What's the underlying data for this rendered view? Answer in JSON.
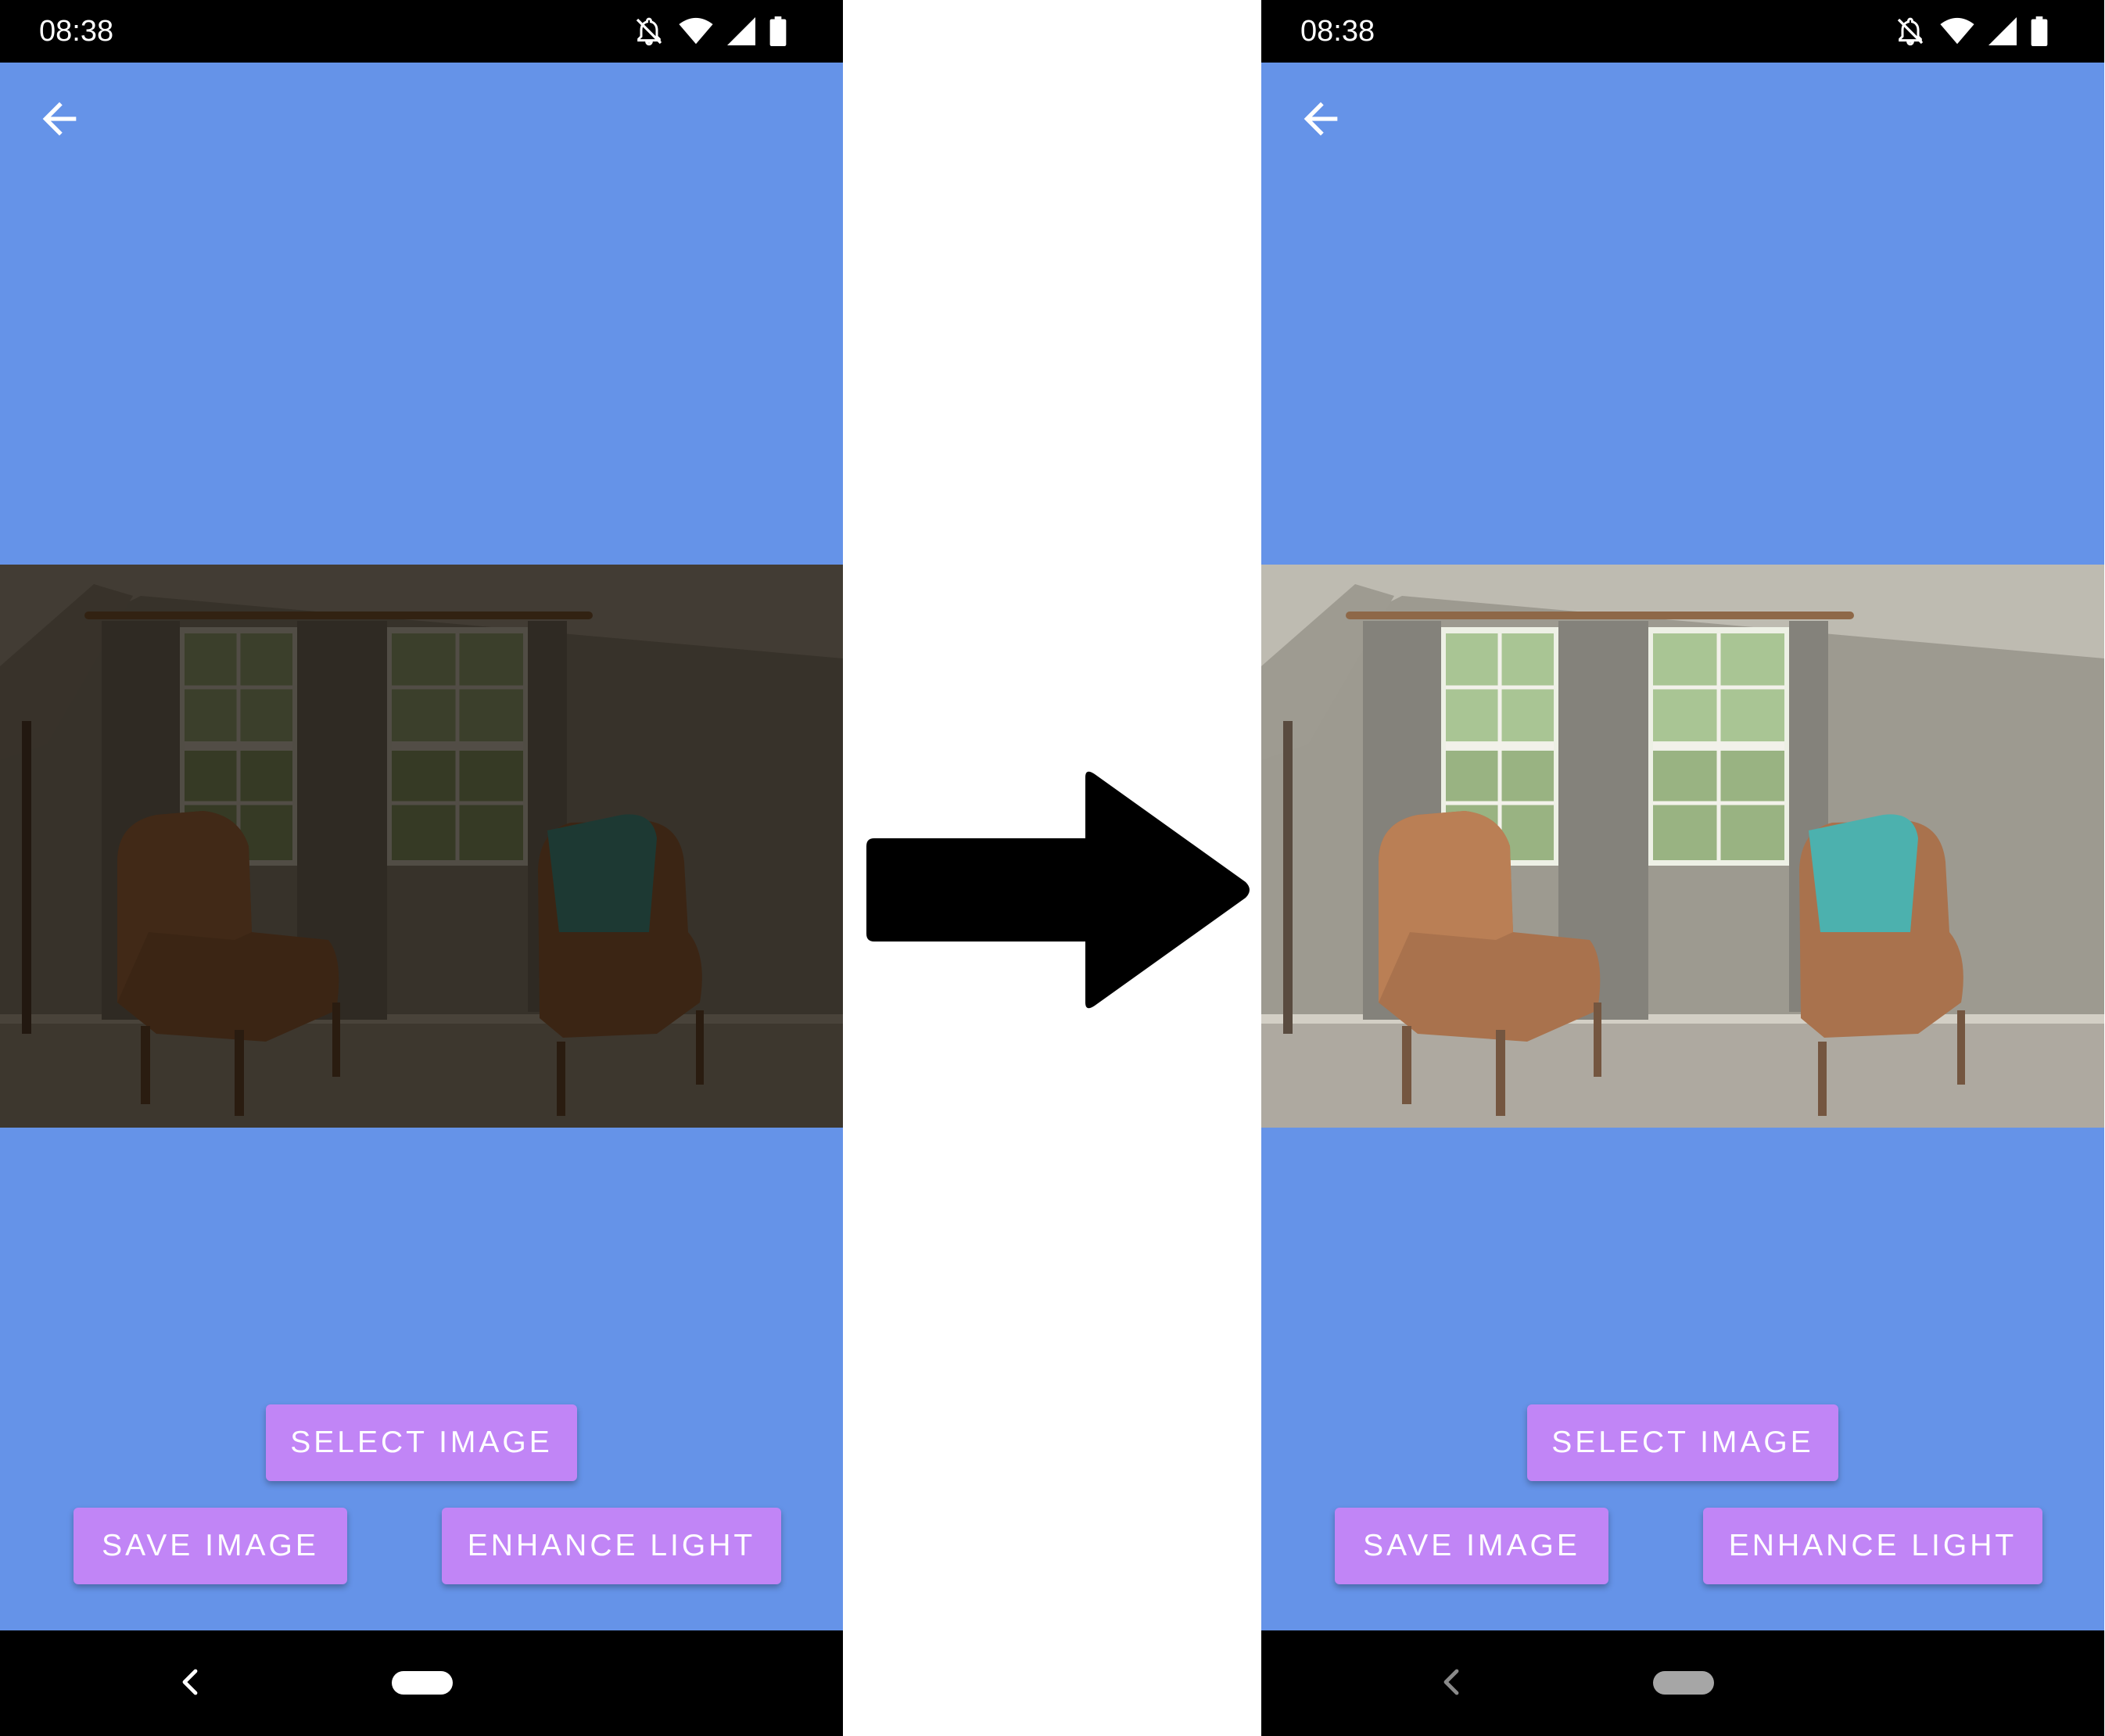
{
  "colors": {
    "app_background": "#6593e8",
    "button_background": "#c185f6",
    "bar_background": "#000000",
    "home_pill_left": "#ffffff",
    "home_pill_right": "#a6a6a6"
  },
  "icons": {
    "status": [
      "notifications-off-icon",
      "wifi-icon",
      "cell-signal-icon",
      "battery-icon"
    ],
    "toolbar": "arrow-back-icon",
    "navigation": [
      "nav-back-icon",
      "nav-home-pill"
    ],
    "transition": "right-arrow-icon"
  },
  "before_screen": {
    "status_bar": {
      "time": "08:38"
    },
    "buttons": {
      "select": "SELECT IMAGE",
      "save": "SAVE IMAGE",
      "enhance": "ENHANCE LIGHT"
    }
  },
  "after_screen": {
    "status_bar": {
      "time": "08:38"
    },
    "buttons": {
      "select": "SELECT IMAGE",
      "save": "SAVE IMAGE",
      "enhance": "ENHANCE LIGHT"
    }
  }
}
